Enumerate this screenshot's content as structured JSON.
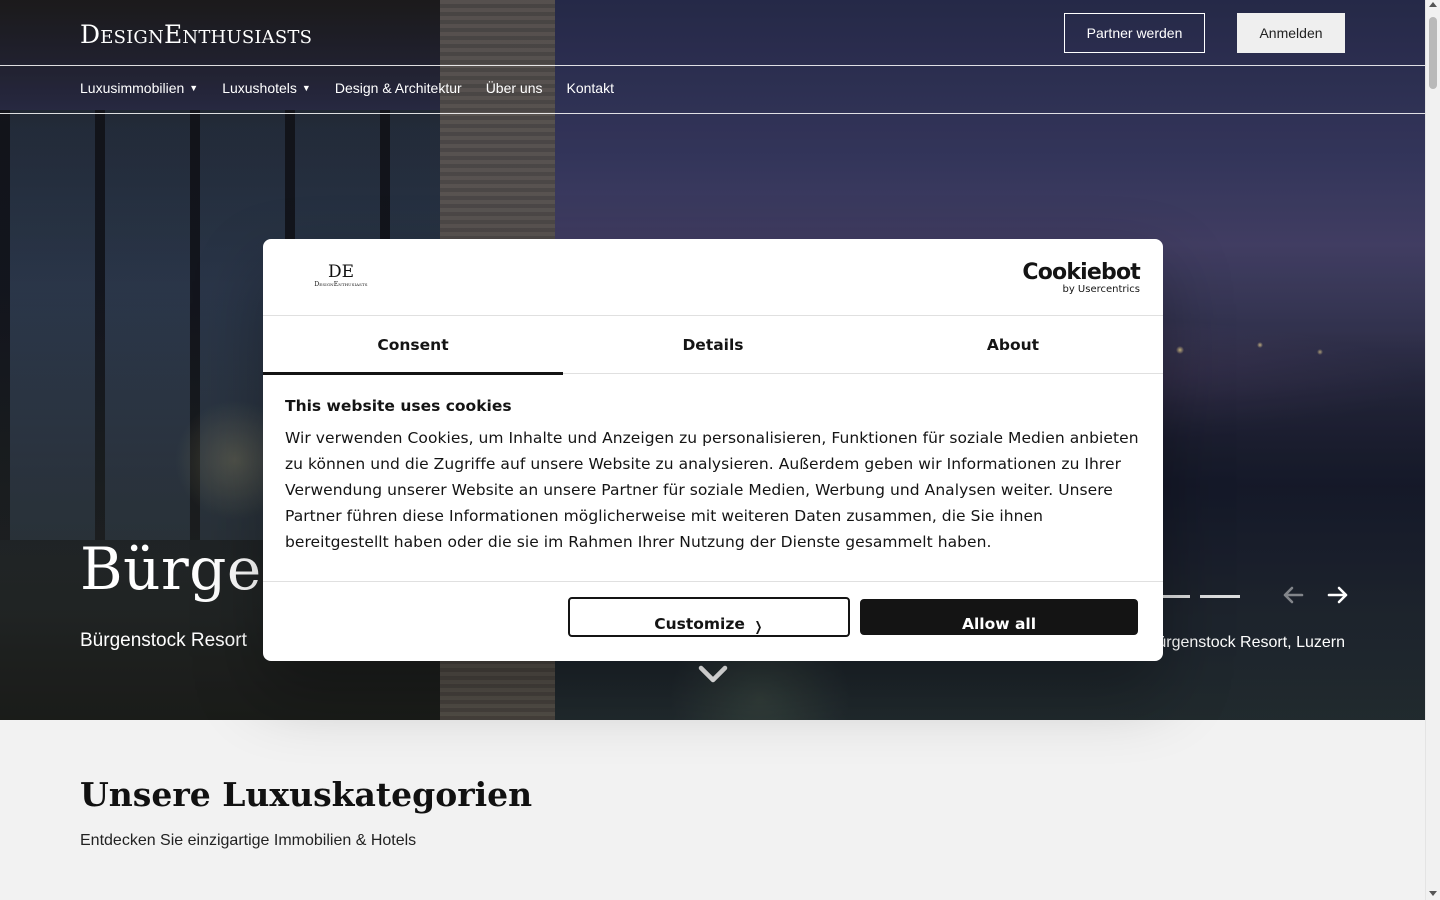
{
  "header": {
    "brand": "DesignEnthusiasts",
    "partner_button": "Partner werden",
    "login_button": "Anmelden"
  },
  "nav": {
    "items": [
      {
        "label": "Luxusimmobilien",
        "dropdown": true
      },
      {
        "label": "Luxushotels",
        "dropdown": true
      },
      {
        "label": "Design & Architektur",
        "dropdown": false
      },
      {
        "label": "Über uns",
        "dropdown": false
      },
      {
        "label": "Kontakt",
        "dropdown": false
      }
    ]
  },
  "hero": {
    "title": "Bürgenstock",
    "subtitle": "Bürgenstock Resort",
    "credit": "Bürgenstock Resort, Luzern"
  },
  "section": {
    "title": "Unsere Luxuskategorien",
    "subtitle": "Entdecken Sie einzigartige Immobilien & Hotels"
  },
  "cookie_dialog": {
    "logo_main": "DE",
    "logo_sub": "DesignEnthusiasts",
    "provider_name": "Cookiebot",
    "provider_by": "by Usercentrics",
    "tabs": [
      {
        "label": "Consent",
        "active": true
      },
      {
        "label": "Details",
        "active": false
      },
      {
        "label": "About",
        "active": false
      }
    ],
    "heading": "This website uses cookies",
    "body": "Wir verwenden Cookies, um Inhalte und Anzeigen zu personalisieren, Funktionen für soziale Medien anbieten zu können und die Zugriffe auf unsere Website zu analysieren. Außerdem geben wir Informationen zu Ihrer Verwendung unserer Website an unsere Partner für soziale Medien, Werbung und Analysen weiter. Unsere Partner führen diese Informationen möglicherweise mit weiteren Daten zusammen, die Sie ihnen bereitgestellt haben oder die sie im Rahmen Ihrer Nutzung der Dienste gesammelt haben.",
    "customize_button": "Customize",
    "allow_button": "Allow all"
  },
  "colors": {
    "dialog_text": "#141414",
    "page_background": "#f2f2f2"
  }
}
